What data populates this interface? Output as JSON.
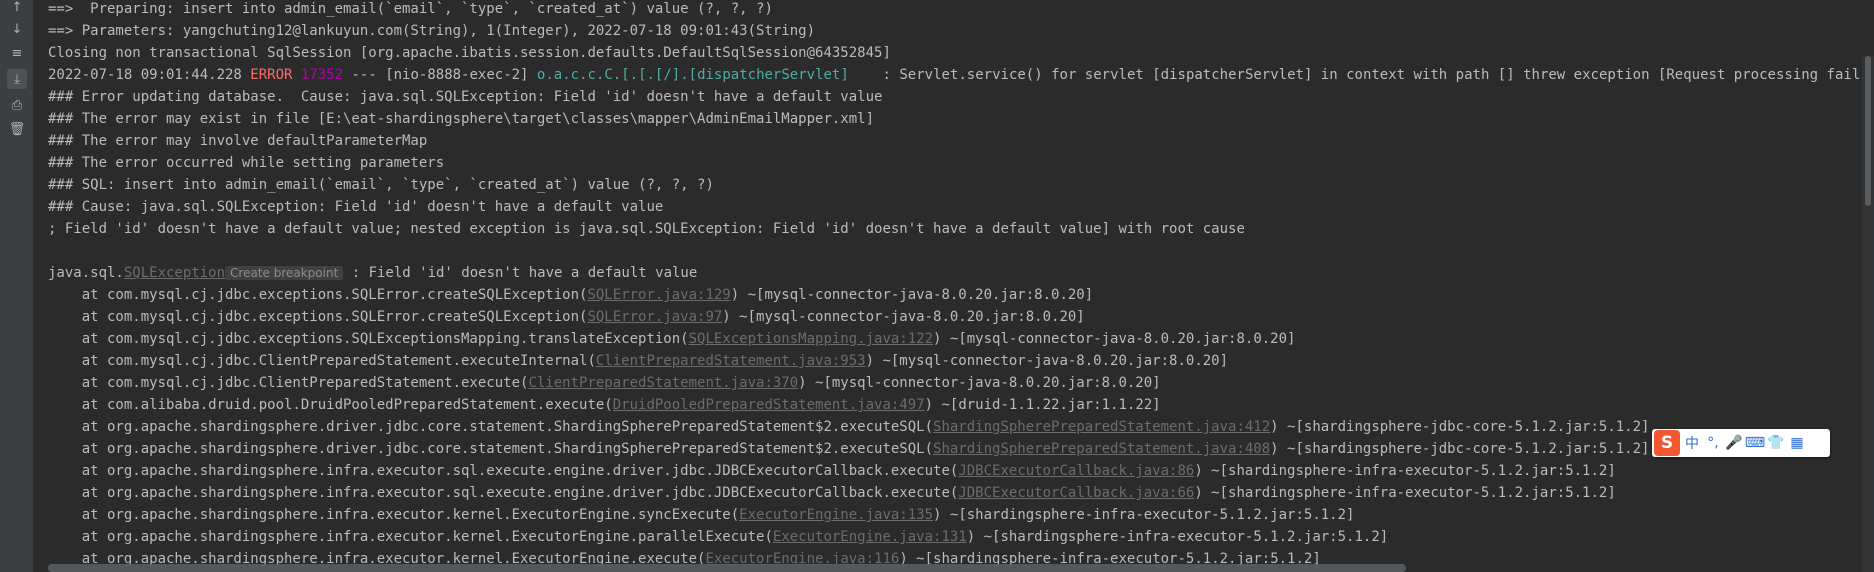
{
  "colors": {
    "background": "#2b2b2b",
    "text": "#bbbbbb",
    "error": "#ff6b68",
    "pid": "#b200b2",
    "logger": "#4eada4",
    "link": "#6a6d70",
    "ime_accent": "#2f6fd6",
    "ime_logo": "#f2572f"
  },
  "gutter": {
    "icons": [
      {
        "name": "scroll-up-icon",
        "glyph": "↑",
        "active": false
      },
      {
        "name": "scroll-down-icon",
        "glyph": "↓",
        "active": false
      },
      {
        "name": "soft-wrap-icon",
        "glyph": "≡",
        "active": false
      },
      {
        "name": "scroll-to-end-icon",
        "glyph": "⤓",
        "active": true
      },
      {
        "name": "print-icon",
        "glyph": "⎙",
        "active": false
      },
      {
        "name": "trash-icon",
        "glyph": "🗑",
        "active": false
      }
    ]
  },
  "console": {
    "lines": [
      [
        {
          "t": "==>  Preparing: insert into admin_email(`email`, `type`, `created_at`) value (?, ?, ?)"
        }
      ],
      [
        {
          "t": "==> Parameters: yangchuting12@lankuyun.com(String), 1(Integer), 2022-07-18 09:01:43(String)"
        }
      ],
      [
        {
          "t": "Closing non transactional SqlSession [org.apache.ibatis.session.defaults.DefaultSqlSession@64352845]"
        }
      ],
      [
        {
          "t": "2022-07-18 09:01:44.228 "
        },
        {
          "t": "ERROR",
          "c": "error"
        },
        {
          "t": " "
        },
        {
          "t": "17352",
          "c": "pid"
        },
        {
          "t": " --- [nio-8888-exec-2] "
        },
        {
          "t": "o.a.c.c.C.[.[.[/].[dispatcherServlet]",
          "c": "logger"
        },
        {
          "t": "    : Servlet.service() for servlet [dispatcherServlet] in context with path [] threw exception [Request processing failed; nested"
        }
      ],
      [
        {
          "t": "### Error updating database.  Cause: java.sql.SQLException: Field 'id' doesn't have a default value"
        }
      ],
      [
        {
          "t": "### The error may exist in file [E:\\eat-shardingsphere\\target\\classes\\mapper\\AdminEmailMapper.xml]"
        }
      ],
      [
        {
          "t": "### The error may involve defaultParameterMap"
        }
      ],
      [
        {
          "t": "### The error occurred while setting parameters"
        }
      ],
      [
        {
          "t": "### SQL: insert into admin_email(`email`, `type`, `created_at`) value (?, ?, ?)"
        }
      ],
      [
        {
          "t": "### Cause: java.sql.SQLException: Field 'id' doesn't have a default value"
        }
      ],
      [
        {
          "t": "; Field 'id' doesn't have a default value; nested exception is java.sql.SQLException: Field 'id' doesn't have a default value] with root cause"
        }
      ],
      [
        {
          "t": ""
        }
      ],
      [
        {
          "t": "java.sql."
        },
        {
          "t": "SQLException",
          "c": "link"
        },
        {
          "t": "Create breakpoint",
          "c": "chip"
        },
        {
          "t": " : Field 'id' doesn't have a default value"
        }
      ],
      [
        {
          "t": "    at com.mysql.cj.jdbc.exceptions.SQLError.createSQLException("
        },
        {
          "t": "SQLError.java:129",
          "c": "link"
        },
        {
          "t": ") ~[mysql-connector-java-8.0.20.jar:8.0.20]"
        }
      ],
      [
        {
          "t": "    at com.mysql.cj.jdbc.exceptions.SQLError.createSQLException("
        },
        {
          "t": "SQLError.java:97",
          "c": "link"
        },
        {
          "t": ") ~[mysql-connector-java-8.0.20.jar:8.0.20]"
        }
      ],
      [
        {
          "t": "    at com.mysql.cj.jdbc.exceptions.SQLExceptionsMapping.translateException("
        },
        {
          "t": "SQLExceptionsMapping.java:122",
          "c": "link"
        },
        {
          "t": ") ~[mysql-connector-java-8.0.20.jar:8.0.20]"
        }
      ],
      [
        {
          "t": "    at com.mysql.cj.jdbc.ClientPreparedStatement.executeInternal("
        },
        {
          "t": "ClientPreparedStatement.java:953",
          "c": "link"
        },
        {
          "t": ") ~[mysql-connector-java-8.0.20.jar:8.0.20]"
        }
      ],
      [
        {
          "t": "    at com.mysql.cj.jdbc.ClientPreparedStatement.execute("
        },
        {
          "t": "ClientPreparedStatement.java:370",
          "c": "link"
        },
        {
          "t": ") ~[mysql-connector-java-8.0.20.jar:8.0.20]"
        }
      ],
      [
        {
          "t": "    at com.alibaba.druid.pool.DruidPooledPreparedStatement.execute("
        },
        {
          "t": "DruidPooledPreparedStatement.java:497",
          "c": "link"
        },
        {
          "t": ") ~[druid-1.1.22.jar:1.1.22]"
        }
      ],
      [
        {
          "t": "    at org.apache.shardingsphere.driver.jdbc.core.statement.ShardingSpherePreparedStatement$2.executeSQL("
        },
        {
          "t": "ShardingSpherePreparedStatement.java:412",
          "c": "link"
        },
        {
          "t": ") ~[shardingsphere-jdbc-core-5.1.2.jar:5.1.2]"
        }
      ],
      [
        {
          "t": "    at org.apache.shardingsphere.driver.jdbc.core.statement.ShardingSpherePreparedStatement$2.executeSQL("
        },
        {
          "t": "ShardingSpherePreparedStatement.java:408",
          "c": "link"
        },
        {
          "t": ") ~[shardingsphere-jdbc-core-5.1.2.jar:5.1.2]"
        }
      ],
      [
        {
          "t": "    at org.apache.shardingsphere.infra.executor.sql.execute.engine.driver.jdbc.JDBCExecutorCallback.execute("
        },
        {
          "t": "JDBCExecutorCallback.java:86",
          "c": "link"
        },
        {
          "t": ") ~[shardingsphere-infra-executor-5.1.2.jar:5.1.2]"
        }
      ],
      [
        {
          "t": "    at org.apache.shardingsphere.infra.executor.sql.execute.engine.driver.jdbc.JDBCExecutorCallback.execute("
        },
        {
          "t": "JDBCExecutorCallback.java:66",
          "c": "link"
        },
        {
          "t": ") ~[shardingsphere-infra-executor-5.1.2.jar:5.1.2]"
        }
      ],
      [
        {
          "t": "    at org.apache.shardingsphere.infra.executor.kernel.ExecutorEngine.syncExecute("
        },
        {
          "t": "ExecutorEngine.java:135",
          "c": "link"
        },
        {
          "t": ") ~[shardingsphere-infra-executor-5.1.2.jar:5.1.2]"
        }
      ],
      [
        {
          "t": "    at org.apache.shardingsphere.infra.executor.kernel.ExecutorEngine.parallelExecute("
        },
        {
          "t": "ExecutorEngine.java:131",
          "c": "link"
        },
        {
          "t": ") ~[shardingsphere-infra-executor-5.1.2.jar:5.1.2]"
        }
      ],
      [
        {
          "t": "    at org.apache.shardingsphere.infra.executor.kernel.ExecutorEngine.execute("
        },
        {
          "t": "ExecutorEngine.java:116",
          "c": "link"
        },
        {
          "t": ") ~[shardingsphere-infra-executor-5.1.2.jar:5.1.2]"
        }
      ]
    ]
  },
  "ime": {
    "logo": "S",
    "items": [
      {
        "name": "chinese-mode-icon",
        "glyph": "中"
      },
      {
        "name": "punctuation-icon",
        "glyph": "°,"
      },
      {
        "name": "microphone-icon",
        "glyph": "🎤"
      },
      {
        "name": "keyboard-icon",
        "glyph": "⌨"
      },
      {
        "name": "skin-icon",
        "glyph": "👕"
      },
      {
        "name": "toolbox-icon",
        "glyph": "▦"
      }
    ]
  }
}
